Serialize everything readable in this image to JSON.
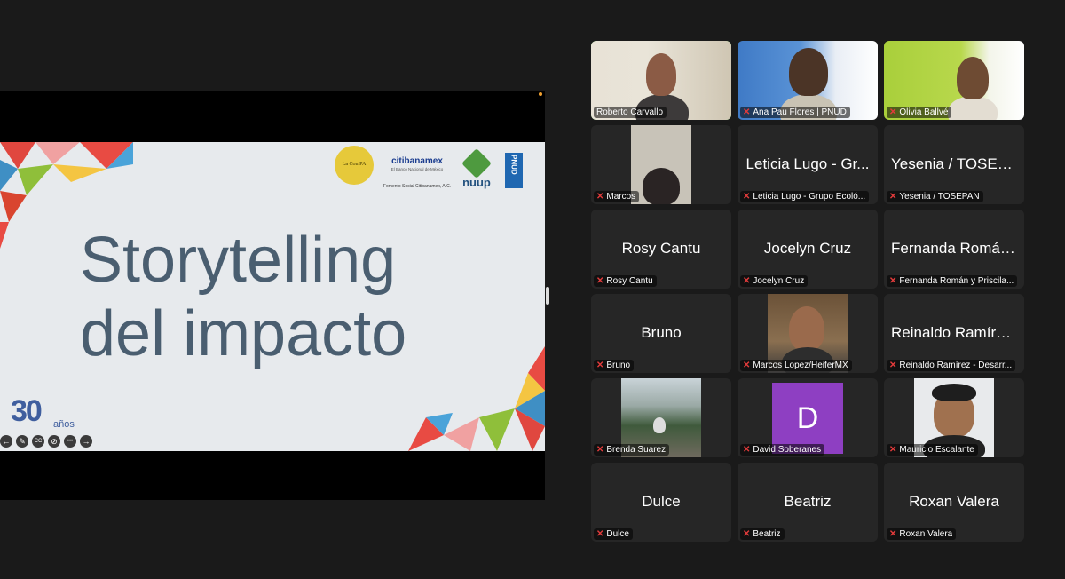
{
  "slide": {
    "title_line1": "Storytelling",
    "title_line2": "del impacto",
    "logo_compa": "La ComPA",
    "logo_citi": "citibanamex",
    "logo_citi_sub": "El Banco Nacional de México",
    "logo_citi_sub2": "Fomento Social Citibanamex, A.C.",
    "logo_nuup": "nuup",
    "logo_undp": "PNUD",
    "anniv_num": "30",
    "anniv_years": "años"
  },
  "toolbar": {
    "prev": "←",
    "pen": "✎",
    "cc": "CC",
    "video": "⊘",
    "more": "•••",
    "next": "→"
  },
  "participants": [
    {
      "name": "Roberto Carvallo",
      "has_video": true,
      "muted": false,
      "active": true
    },
    {
      "name": "Ana Pau Flores | PNUD",
      "has_video": true,
      "muted": true
    },
    {
      "name": "Olivia Ballvé",
      "has_video": true,
      "muted": true
    },
    {
      "name": "Marcos",
      "has_video": true,
      "muted": true
    },
    {
      "name": "Leticia Lugo - Grupo Ecoló...",
      "display": "Leticia Lugo - Gr...",
      "muted": true
    },
    {
      "name": "Yesenia / TOSEPAN",
      "display": "Yesenia / TOSEP...",
      "muted": true
    },
    {
      "name": "Rosy Cantu",
      "display": "Rosy Cantu",
      "muted": true
    },
    {
      "name": "Jocelyn Cruz",
      "display": "Jocelyn Cruz",
      "muted": true
    },
    {
      "name": "Fernanda Román y Priscila...",
      "display": "Fernanda Román...",
      "muted": true
    },
    {
      "name": "Bruno",
      "display": "Bruno",
      "muted": true
    },
    {
      "name": "Marcos Lopez/HeiferMX",
      "has_video": true,
      "muted": true
    },
    {
      "name": "Reinaldo Ramírez - Desarr...",
      "display": "Reinaldo Ramírez...",
      "muted": true
    },
    {
      "name": "Brenda Suarez",
      "has_video": true,
      "muted": true
    },
    {
      "name": "David Soberanes",
      "avatar_letter": "D",
      "muted": true
    },
    {
      "name": "Mauricio Escalante",
      "has_video": true,
      "muted": true
    },
    {
      "name": "Dulce",
      "display": "Dulce",
      "muted": true
    },
    {
      "name": "Beatriz",
      "display": "Beatriz",
      "muted": true
    },
    {
      "name": "Roxan Valera",
      "display": "Roxan Valera",
      "muted": true
    }
  ],
  "colors": {
    "active_speaker": "#45d045",
    "muted": "#e23b3b",
    "avatar_bg": "#8e3fc2",
    "slide_text": "#4a5e70"
  }
}
